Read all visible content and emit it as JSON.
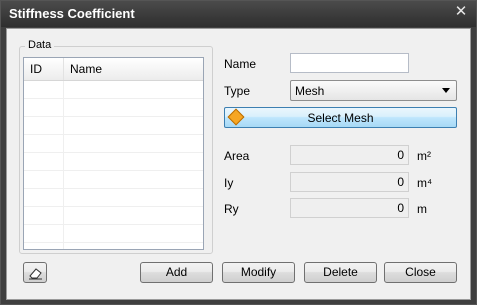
{
  "window": {
    "title": "Stiffness Coefficient",
    "close_glyph": "✕"
  },
  "data_group": {
    "title": "Data",
    "columns": [
      "ID",
      "Name"
    ]
  },
  "form": {
    "name_label": "Name",
    "name_value": "",
    "type_label": "Type",
    "type_value": "Mesh",
    "select_button": "Select Mesh",
    "area_label": "Area",
    "area_value": "0",
    "area_unit": "m²",
    "iy_label": "Iy",
    "iy_value": "0",
    "iy_unit": "m⁴",
    "ry_label": "Ry",
    "ry_value": "0",
    "ry_unit": "m"
  },
  "buttons": {
    "add": "Add",
    "modify": "Modify",
    "delete": "Delete",
    "close": "Close"
  },
  "icons": {
    "select_mesh": "diamond-icon",
    "clear": "eraser-icon"
  },
  "colors": {
    "title_bar": "#2e2e2e",
    "select_button_accent": "#a7d9f5",
    "diamond": "#f6a623"
  }
}
